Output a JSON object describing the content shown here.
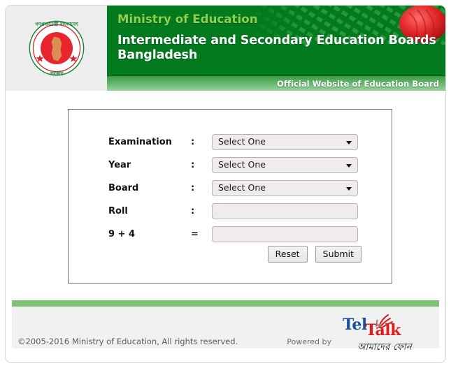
{
  "header": {
    "emblem_icon": "bangladesh-government-emblem-icon",
    "flag_decoration_icon": "bangladesh-flag-icon",
    "ministry": "Ministry of Education",
    "title_line1": "Intermediate and Secondary Education Boards",
    "title_line2": "Bangladesh",
    "official_strip": "Official Website of Education Board",
    "colors": {
      "banner_green": "#037a1e",
      "ministry_green": "#8fd14f",
      "strip_green": "#5cb065"
    }
  },
  "form": {
    "rows": [
      {
        "label": "Examination",
        "separator": ":",
        "type": "select",
        "value": "Select One"
      },
      {
        "label": "Year",
        "separator": ":",
        "type": "select",
        "value": "Select One"
      },
      {
        "label": "Board",
        "separator": ":",
        "type": "select",
        "value": "Select One"
      },
      {
        "label": "Roll",
        "separator": ":",
        "type": "text",
        "value": ""
      },
      {
        "label": "9 + 4",
        "separator": "=",
        "type": "text",
        "value": ""
      }
    ],
    "reset_label": "Reset",
    "submit_label": "Submit"
  },
  "footer": {
    "copyright": "©2005-2016 Ministry of Education, All rights reserved.",
    "powered_by": "Powered by",
    "brand": {
      "part1": "Tel",
      "part2": "Talk",
      "tagline": "আমাদের ফোন"
    },
    "bar_color": "#7ec474"
  }
}
